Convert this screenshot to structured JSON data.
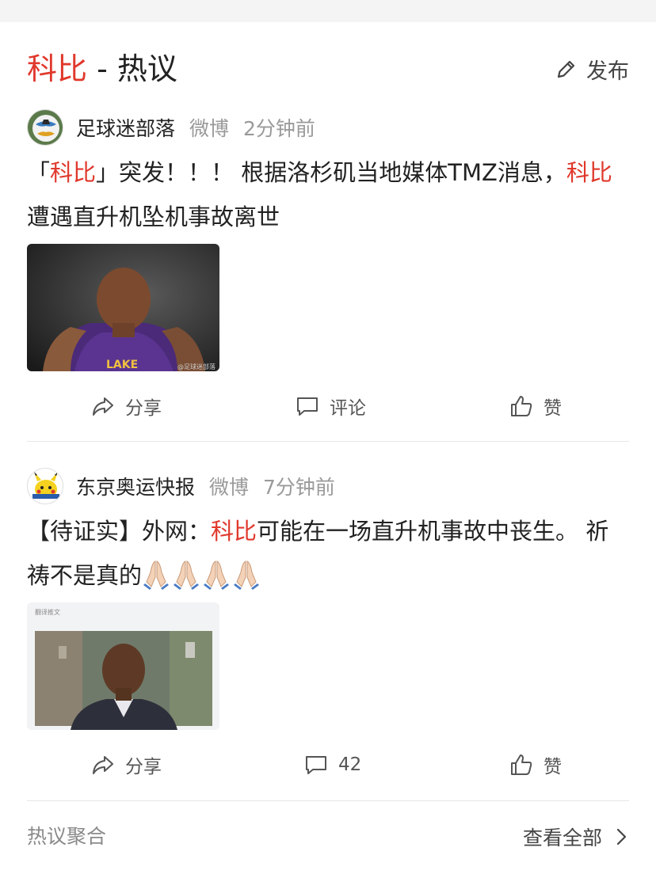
{
  "section": {
    "title_highlight": "科比",
    "title_rest": " - 热议",
    "publish_label": "发布",
    "publish_icon": "pencil-icon"
  },
  "posts": [
    {
      "author": "足球迷部落",
      "source": "微博",
      "time": "2分钟前",
      "text_parts": [
        "「",
        "科比",
        "」突发！！！ 根据洛杉矶当地媒体TMZ消息，",
        "科比",
        "遭遇直升机坠机事故离世"
      ],
      "image_caption": "@足球迷部落",
      "share_label": "分享",
      "comment_label": "评论",
      "like_label": "赞"
    },
    {
      "author": "东京奥运快报",
      "source": "微博",
      "time": "7分钟前",
      "text_parts": [
        "【待证实】外网：",
        "科比",
        "可能在一场直升机事故中丧生。 祈祷不是真的"
      ],
      "image_header": "翻译推文",
      "share_label": "分享",
      "comment_count": "42",
      "like_label": "赞"
    }
  ],
  "footer": {
    "left_label": "热议聚合",
    "right_label": "查看全部"
  },
  "colors": {
    "highlight": "#e0382c",
    "text": "#222222",
    "muted": "#9a9a9a"
  }
}
